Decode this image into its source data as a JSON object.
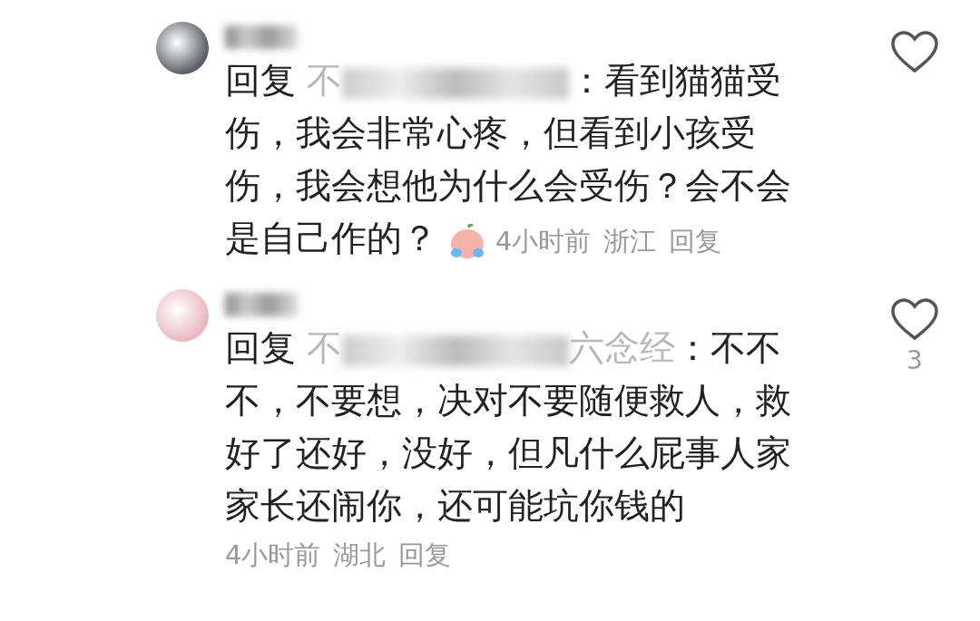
{
  "comments": [
    {
      "reply_label": "回复",
      "reply_to": "不",
      "text": "：看到猫猫受伤，我会非常心疼，但看到小孩受伤，我会想他为什么会受伤？会不会是自己作的？",
      "has_emoji": true,
      "time": "4小时前",
      "location": "浙江",
      "reply_button": "回复",
      "liked": false
    },
    {
      "reply_label": "回复",
      "reply_to": "不",
      "reply_to_tail": "六念经",
      "text": "：不不不，不要想，决对不要随便救人，救好了还好，没好，但凡什么屁事人家家长还闹你，还可能坑你钱的",
      "has_emoji": false,
      "time": "4小时前",
      "location": "湖北",
      "reply_button": "回复",
      "liked": false,
      "like_count": "3"
    }
  ]
}
